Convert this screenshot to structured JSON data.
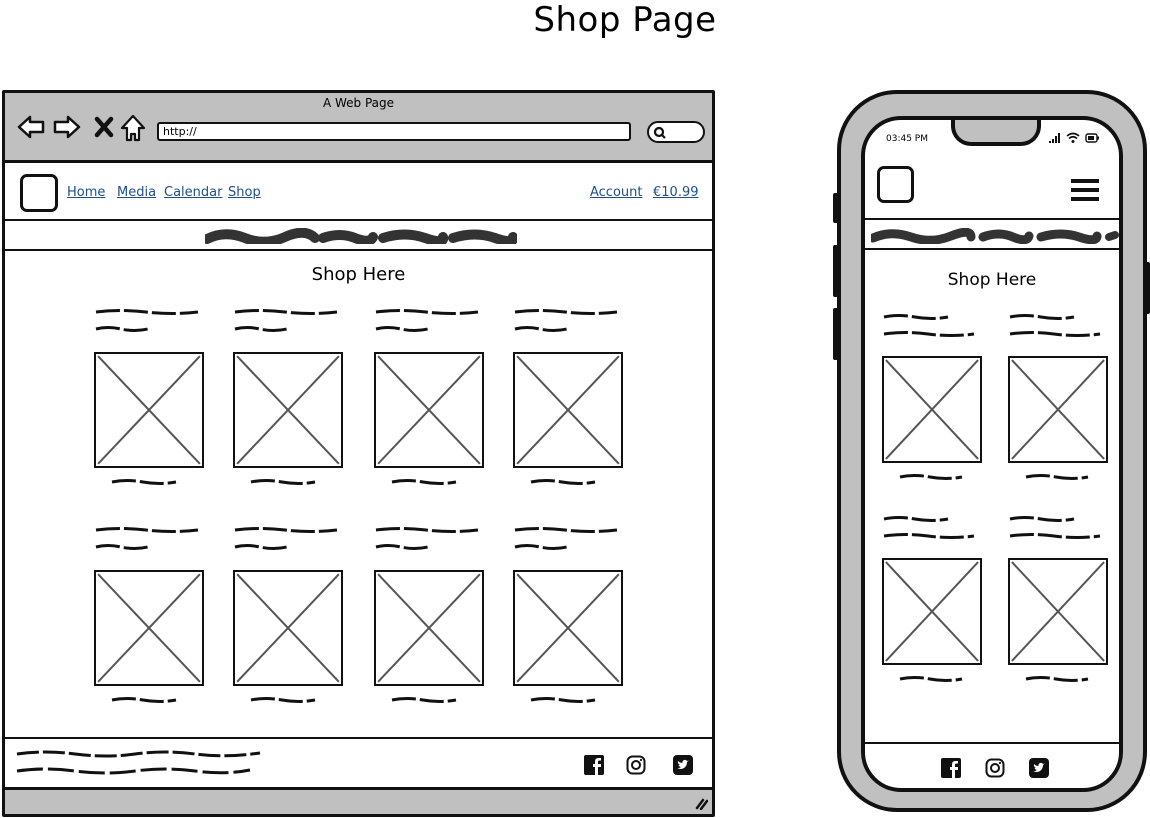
{
  "page_title": "Shop Page",
  "browser": {
    "window_title": "A Web Page",
    "url": "http://",
    "nav_buttons": [
      "back-arrow-icon",
      "forward-arrow-icon",
      "stop-icon",
      "home-icon"
    ],
    "nav_links": [
      "Home",
      "Media",
      "Calendar",
      "Shop"
    ],
    "account_link": "Account",
    "cart_total": "€10.99",
    "section_title": "Shop Here",
    "banner_text": "(scribbled placeholder text)",
    "products": [
      {
        "description": "(scribbled placeholder text)",
        "price": "(scribbled)"
      },
      {
        "description": "(scribbled placeholder text)",
        "price": "(scribbled)"
      },
      {
        "description": "(scribbled placeholder text)",
        "price": "(scribbled)"
      },
      {
        "description": "(scribbled placeholder text)",
        "price": "(scribbled)"
      },
      {
        "description": "(scribbled placeholder text)",
        "price": "(scribbled)"
      },
      {
        "description": "(scribbled placeholder text)",
        "price": "(scribbled)"
      },
      {
        "description": "(scribbled placeholder text)",
        "price": "(scribbled)"
      },
      {
        "description": "(scribbled placeholder text)",
        "price": "(scribbled)"
      }
    ],
    "footer_text": "(scribbled placeholder text)",
    "social_icons": [
      "facebook-icon",
      "instagram-icon",
      "twitter-icon"
    ]
  },
  "phone": {
    "time": "03:45 PM",
    "status_icons": [
      "signal-icon",
      "wifi-icon",
      "battery-icon"
    ],
    "section_title": "Shop Here",
    "banner_text": "(scribbled placeholder text)",
    "products": [
      {
        "description": "(scribbled placeholder text)",
        "price": "(scribbled)"
      },
      {
        "description": "(scribbled placeholder text)",
        "price": "(scribbled)"
      },
      {
        "description": "(scribbled placeholder text)",
        "price": "(scribbled)"
      },
      {
        "description": "(scribbled placeholder text)",
        "price": "(scribbled)"
      }
    ],
    "social_icons": [
      "facebook-icon",
      "instagram-icon",
      "twitter-icon"
    ]
  },
  "colors": {
    "chrome_gray": "#c0c0c0",
    "link_blue": "#1f4e8c",
    "outline": "#111111",
    "placeholder_x": "#555555"
  }
}
